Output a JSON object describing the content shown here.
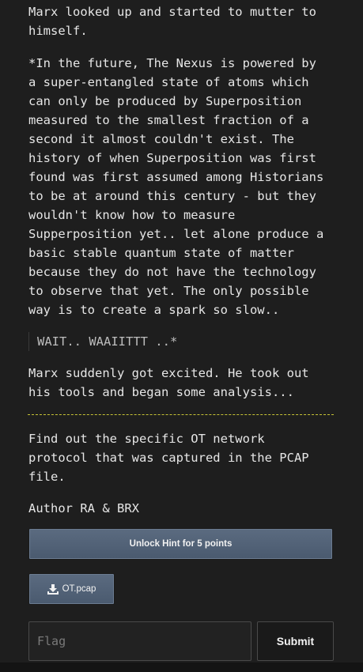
{
  "story": {
    "para1": "Marx looked up and started to mutter to\nhimself.",
    "para2": "*In the future, The Nexus is powered by\na super-entangled state of atoms which\ncan only be produced by Superposition\nmeasured to the smallest fraction of a\nsecond it almost couldn't exist. The\nhistory of when Superposition was first\nfound was first assumed among Historians\nto be at around this century - but they\nwouldn't know how to measure\nSupperposition yet.. let alone produce a\nbasic stable quantum state of matter\nbecause they do not have the technology\nto observe that yet. The only possible\nway is to create a spark so slow..",
    "quote": "WAIT.. WAAIITTT ..*",
    "para3": "Marx suddenly got excited. He took out\nhis tools and began some analysis..."
  },
  "challenge": {
    "description": "Find out the specific OT network\nprotocol that was captured in the PCAP\nfile.",
    "author": "Author RA & BRX"
  },
  "actions": {
    "hint_label": "Unlock Hint for 5 points",
    "file_label": "OT.pcap",
    "file_icon": "download-icon",
    "flag_placeholder": "Flag",
    "flag_value": "",
    "submit_label": "Submit"
  },
  "colors": {
    "background": "#1e1e1e",
    "divider": "#c7c335",
    "button": "#52627a"
  }
}
